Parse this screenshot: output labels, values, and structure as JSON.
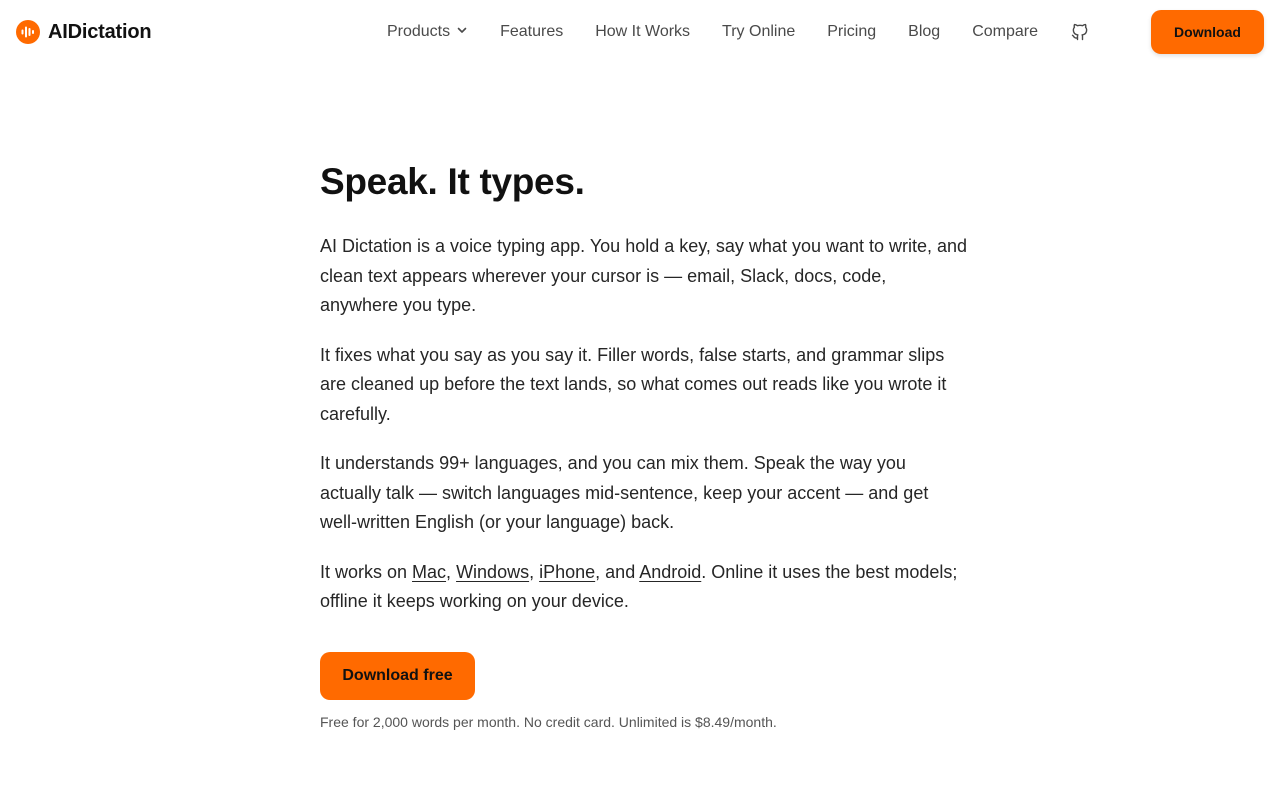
{
  "brand": {
    "name": "AIDictation",
    "accent": "#ff6a00"
  },
  "nav": {
    "items": [
      {
        "label": "Products",
        "icon": "chevron-down-icon"
      },
      {
        "label": "Features"
      },
      {
        "label": "How It Works"
      },
      {
        "label": "Try Online"
      },
      {
        "label": "Pricing"
      },
      {
        "label": "Blog"
      },
      {
        "label": "Compare"
      }
    ],
    "github_icon": "github-icon",
    "download_label": "Download"
  },
  "hero": {
    "title": "Speak. It types.",
    "p1": "AI Dictation is a voice typing app. You hold a key, say what you want to write, and clean text appears wherever your cursor is — email, Slack, docs, code, anywhere you type.",
    "p2": "It fixes what you say as you say it. Filler words, false starts, and grammar slips are cleaned up before the text lands, so what comes out reads like you wrote it carefully.",
    "p3": "It understands 99+ languages, and you can mix them. Speak the way you actually talk — switch languages mid-sentence, keep your accent — and get well-written English (or your language) back.",
    "p4": {
      "prefix": "It works on ",
      "links": [
        "Mac",
        "Windows",
        "iPhone",
        "Android"
      ],
      "sep1": ", ",
      "sep2": ", ",
      "sep3": ", and ",
      "suffix": ". Online it uses the best models; offline it keeps working on your device."
    },
    "cta_label": "Download free",
    "fine_print": "Free for 2,000 words per month. No credit card. Unlimited is $8.49/month."
  }
}
